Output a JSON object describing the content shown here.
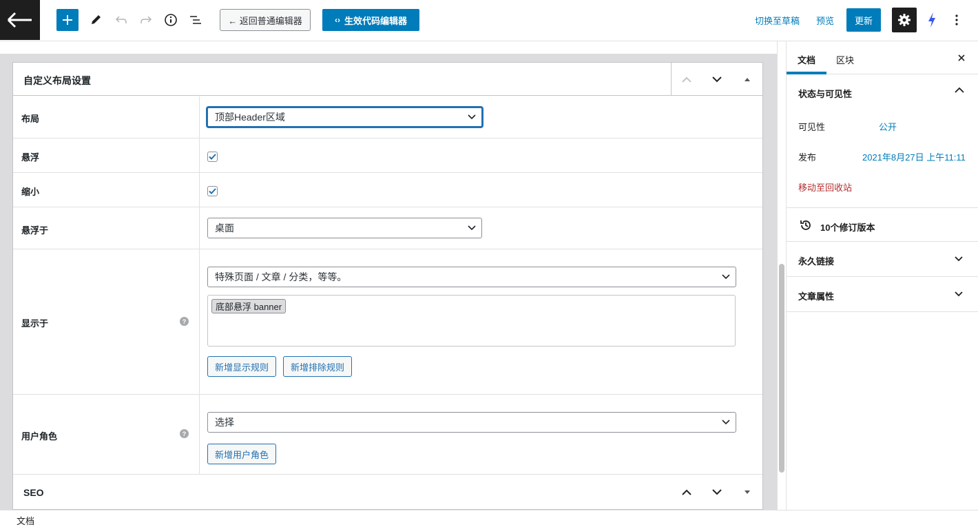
{
  "toolbar": {
    "back_icon": "arrow-left-icon",
    "back_to_classic_label": "← 返回普通编辑器",
    "code_editor_label": "生效代码编辑器",
    "switch_to_draft_label": "切换至草稿",
    "preview_label": "预览",
    "update_label": "更新",
    "accent_color": "#007cba"
  },
  "metabox": {
    "title": "自定义布局设置",
    "rows": {
      "layout": {
        "label": "布局",
        "value": "顶部Header区域"
      },
      "sticky": {
        "label": "悬浮",
        "checked": true
      },
      "shrink": {
        "label": "缩小",
        "checked": true
      },
      "sticky_on": {
        "label": "悬浮于",
        "value": "桌面"
      },
      "display_on": {
        "label": "显示于",
        "select_value": "特殊页面 / 文章 / 分类，等等。",
        "tags": [
          "底部悬浮 banner"
        ],
        "add_display_rule": "新增显示规则",
        "add_exclude_rule": "新增排除规则"
      },
      "user_roles": {
        "label": "用户角色",
        "select_value": "选择",
        "add_user_role": "新增用户角色"
      }
    }
  },
  "seo_box": {
    "title": "SEO"
  },
  "footer": {
    "breadcrumb": "文档"
  },
  "sidebar": {
    "tabs": [
      "文档",
      "区块"
    ],
    "status_panel": {
      "title": "状态与可见性",
      "visibility_label": "可见性",
      "visibility_value": "公开",
      "publish_label": "发布",
      "publish_value": "2021年8月27日 上午11:11",
      "trash_label": "移动至回收站"
    },
    "revisions_label": "10个修订版本",
    "permalink_title": "永久链接",
    "post_attributes_title": "文章属性"
  }
}
